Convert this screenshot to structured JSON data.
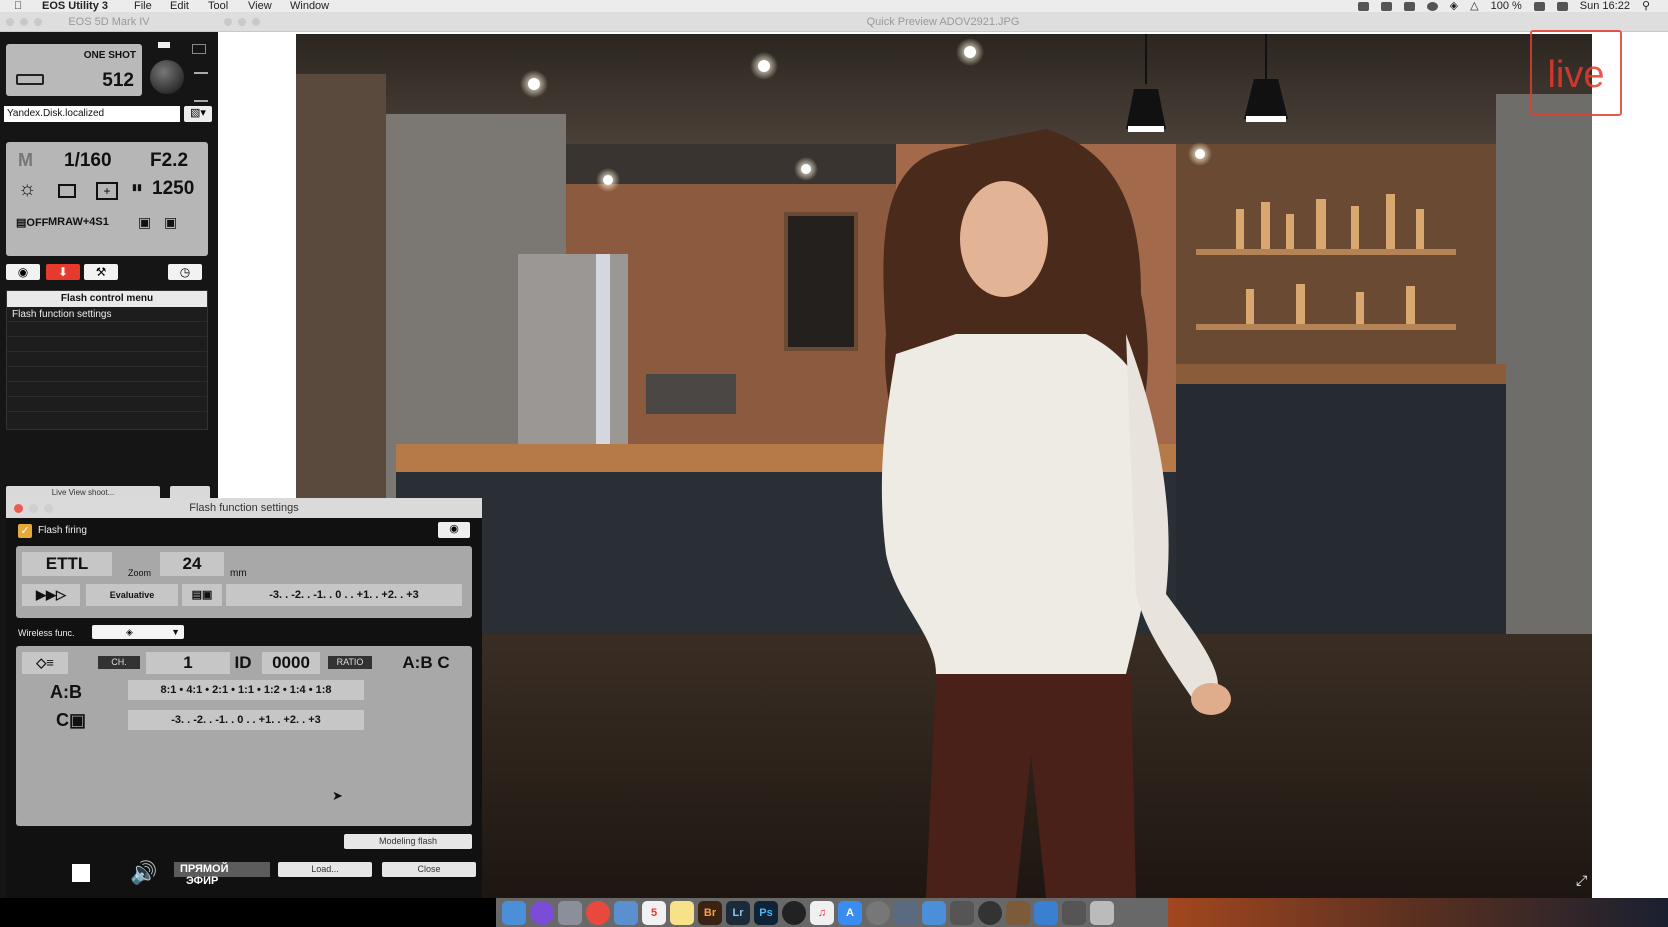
{
  "menubar": {
    "app": "EOS Utility 3",
    "items": [
      "File",
      "Edit",
      "Tool",
      "View",
      "Window"
    ],
    "battery": "100 %",
    "clock": "Sun 16:22"
  },
  "camera_window": {
    "title": "EOS 5D Mark IV"
  },
  "preview_window": {
    "title": "Quick Preview   ADOV2921.JPG"
  },
  "live_badge": "live",
  "camera": {
    "af_mode": "ONE SHOT",
    "shots_remaining": "512",
    "destination": "Yandex.Disk.localized",
    "mode": "M",
    "shutter": "1/160",
    "aperture": "F2.2",
    "iso": "1250",
    "quality": "MRAW+4S1"
  },
  "flash_menu": {
    "header": "Flash control menu",
    "items": [
      "Flash function settings"
    ]
  },
  "live_view_button": "Live View shoot...",
  "ffs": {
    "title": "Flash function settings",
    "flash_firing": "Flash firing",
    "mode": "ETTL",
    "zoom_label": "Zoom",
    "zoom_value": "24",
    "zoom_unit": "mm",
    "metering": "Evaluative",
    "fec_scale": "-3. . -2. . -1. . 0 . . +1. . +2. . +3",
    "wireless_label": "Wireless func.",
    "ch_label": "CH.",
    "ch_value": "1",
    "id_label": "ID",
    "id_value": "0000",
    "ratio_label": "RATIO",
    "groups": "A:B C",
    "ab_label": "A:B",
    "ab_scale": "8:1 • 4:1 • 2:1 • 1:1 • 1:2 • 1:4 • 1:8",
    "c_label": "C",
    "c_scale": "-3. . -2. . -1. . 0 . . +1. . +2. . +3",
    "modeling_flash": "Modeling flash",
    "load": "Load...",
    "close": "Close"
  },
  "overlay": {
    "live_line1": "ПРЯМОЙ",
    "live_line2": "ЭФИР"
  },
  "dock": {
    "apps": [
      "Finder",
      "Siri",
      "Launchpad",
      "Chrome",
      "Preview",
      "Calendar",
      "Notes",
      "Br",
      "Lr",
      "Ps",
      "EOS",
      "iTunes",
      "App Store",
      "Prefs",
      "Photos",
      "Keynote",
      "Camera",
      "QuickTime",
      "Folder",
      "Folder",
      "Folder",
      "Trash"
    ]
  },
  "colors": {
    "flash_tab_active": "#e63a2e",
    "live_red": "#e63a2e",
    "checkbox": "#e8a93b"
  }
}
